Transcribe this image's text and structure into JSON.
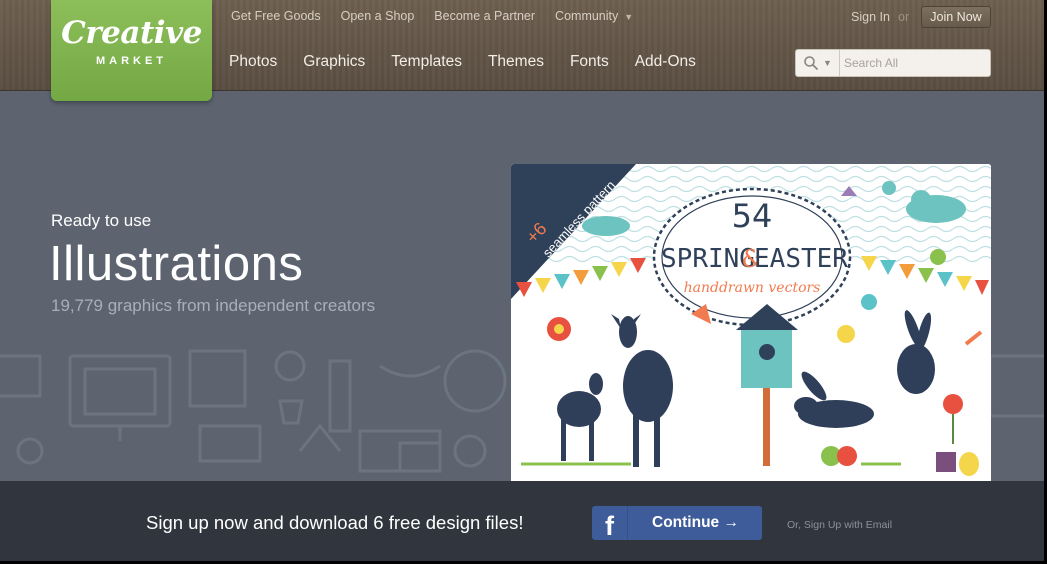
{
  "brand": {
    "wordmark": "Creative",
    "submark": "MARKET",
    "color": "#7db24e"
  },
  "top_links": [
    "Get Free Goods",
    "Open a Shop",
    "Become a Partner",
    "Community"
  ],
  "main_nav": [
    "Photos",
    "Graphics",
    "Templates",
    "Themes",
    "Fonts",
    "Add-Ons"
  ],
  "account": {
    "sign_in": "Sign In",
    "or": "or",
    "join": "Join Now"
  },
  "search": {
    "placeholder": "Search All",
    "value": ""
  },
  "hero": {
    "kicker": "Ready to use",
    "title": "Illustrations",
    "subtitle": "19,779 graphics from independent creators"
  },
  "featured": {
    "badge_count": "+6",
    "badge_text": "seamless pattern",
    "number": "54",
    "title_a": "SPRING",
    "amp": "&",
    "title_b": "EASTER",
    "tagline": "handdrawn vectors"
  },
  "signup": {
    "text": "Sign up now and download 6 free design files!",
    "button_icon": "f",
    "button_label": "Continue →",
    "email_link": "Or, Sign Up with Email"
  },
  "colors": {
    "header_bg": "#64574a",
    "hero_bg": "#5d6470",
    "bottom_bg": "#31363e",
    "facebook": "#3f5c9a"
  }
}
